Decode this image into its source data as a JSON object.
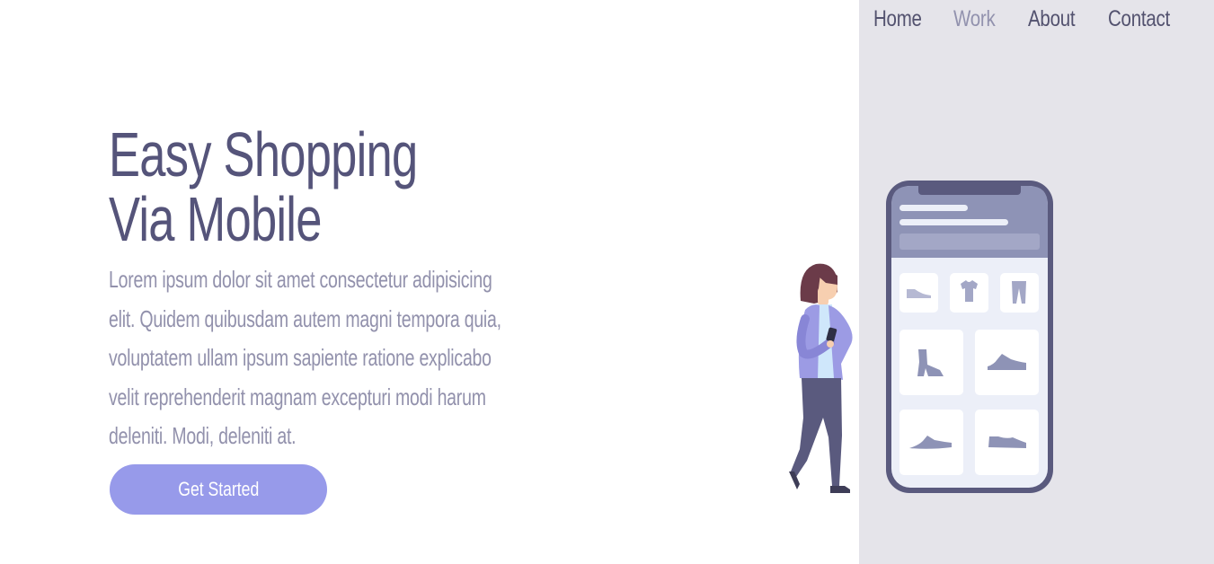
{
  "nav": {
    "items": [
      {
        "label": "Home",
        "active": false
      },
      {
        "label": "Work",
        "active": true
      },
      {
        "label": "About",
        "active": false
      },
      {
        "label": "Contact",
        "active": false
      }
    ]
  },
  "hero": {
    "title_line1": "Easy Shopping",
    "title_line2": "Via Mobile",
    "description_lines": [
      "Lorem ipsum dolor sit amet consectetur adipisicing",
      "elit. Quidem quibusdam autem magni tempora quia,",
      "voluptatem ullam ipsum sapiente ratione explicabo",
      "velit reprehenderit magnam excepturi modi harum",
      "deleniti. Modi, deleniti at."
    ],
    "cta_label": "Get Started"
  },
  "colors": {
    "heading": "#55547a",
    "body_text": "#9291ac",
    "button": "#979aea",
    "side_panel": "#e5e4ea",
    "nav_active": "#9292ae"
  },
  "illustration": {
    "icons": [
      "woman-with-phone",
      "smartphone",
      "flat-shoe-icon",
      "tshirt-icon",
      "pants-icon",
      "boot-icon",
      "sneaker-icon"
    ]
  }
}
